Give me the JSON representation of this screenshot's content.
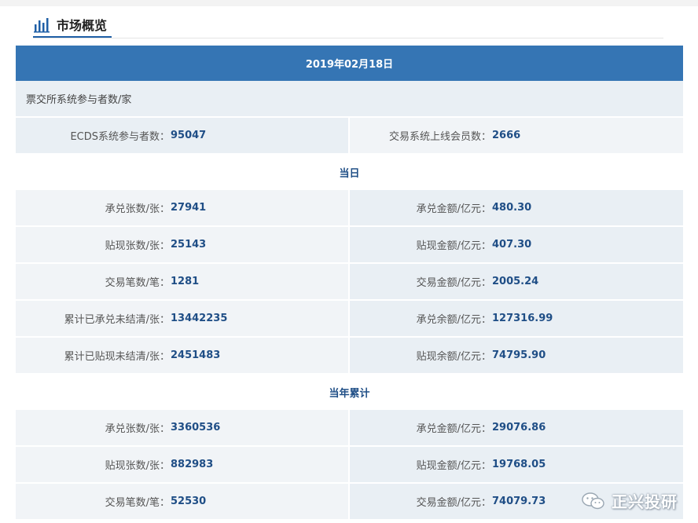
{
  "header": {
    "title": "市场概览",
    "icon": "bar-chart-icon",
    "accent_color": "#1f5fa6"
  },
  "date_row": {
    "text": "2019年02月18日",
    "bg_color": "#3575b4"
  },
  "participants": {
    "section_label": "票交所系统参与者数/家",
    "items": [
      {
        "label": "ECDS系统参与者数：",
        "value": "95047"
      },
      {
        "label": "交易系统上线会员数：",
        "value": "2666"
      }
    ]
  },
  "daily": {
    "title": "当日",
    "rows": [
      [
        {
          "label": "承兑张数/张：",
          "value": "27941"
        },
        {
          "label": "承兑金额/亿元：",
          "value": "480.30"
        }
      ],
      [
        {
          "label": "贴现张数/张：",
          "value": "25143"
        },
        {
          "label": "贴现金额/亿元：",
          "value": "407.30"
        }
      ],
      [
        {
          "label": "交易笔数/笔：",
          "value": "1281"
        },
        {
          "label": "交易金额/亿元：",
          "value": "2005.24"
        }
      ],
      [
        {
          "label": "累计已承兑未结清/张：",
          "value": "13442235"
        },
        {
          "label": "承兑余额/亿元：",
          "value": "127316.99"
        }
      ],
      [
        {
          "label": "累计已贴现未结清/张：",
          "value": "2451483"
        },
        {
          "label": "贴现余额/亿元：",
          "value": "74795.90"
        }
      ]
    ]
  },
  "yearly": {
    "title": "当年累计",
    "rows": [
      [
        {
          "label": "承兑张数/张：",
          "value": "3360536"
        },
        {
          "label": "承兑金额/亿元：",
          "value": "29076.86"
        }
      ],
      [
        {
          "label": "贴现张数/张：",
          "value": "882983"
        },
        {
          "label": "贴现金额/亿元：",
          "value": "19768.05"
        }
      ],
      [
        {
          "label": "交易笔数/笔：",
          "value": "52530"
        },
        {
          "label": "交易金额/亿元：",
          "value": "74079.73"
        }
      ]
    ]
  },
  "watermark": {
    "text": "正兴投研",
    "icon": "wechat-icon"
  },
  "colors": {
    "value_text": "#1f4e86",
    "row_bg_a": "#e9eff4",
    "row_bg_b": "#f1f4f7"
  }
}
